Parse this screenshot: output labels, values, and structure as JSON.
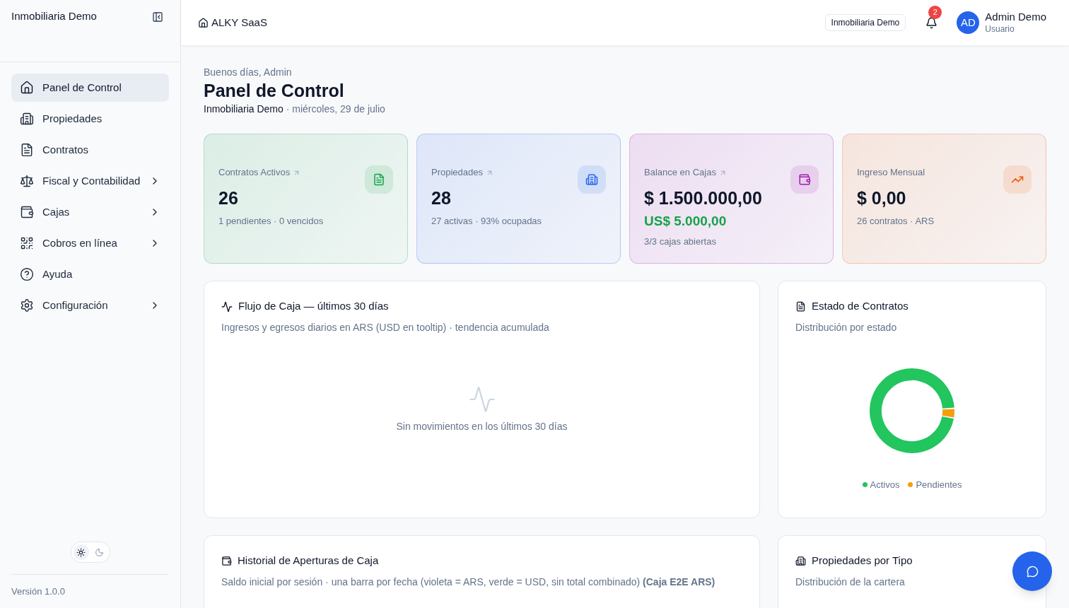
{
  "sidebar": {
    "org": "Inmobiliaria Demo",
    "items": [
      {
        "label": "Panel de Control",
        "selected": true,
        "expandable": false
      },
      {
        "label": "Propiedades",
        "selected": false,
        "expandable": false
      },
      {
        "label": "Contratos",
        "selected": false,
        "expandable": false
      },
      {
        "label": "Fiscal y Contabilidad",
        "selected": false,
        "expandable": true
      },
      {
        "label": "Cajas",
        "selected": false,
        "expandable": true
      },
      {
        "label": "Cobros en línea",
        "selected": false,
        "expandable": true
      },
      {
        "label": "Ayuda",
        "selected": false,
        "expandable": false
      },
      {
        "label": "Configuración",
        "selected": false,
        "expandable": true
      }
    ],
    "theme_options": [
      {
        "selected": true
      },
      {
        "selected": false
      }
    ],
    "version": "Versión 1.0.0"
  },
  "header": {
    "app": "ALKY SaaS",
    "org_badge": "Inmobiliaria Demo",
    "notifications": "2",
    "user": {
      "initials": "AD",
      "name": "Admin Demo",
      "role": "Usuario"
    }
  },
  "page": {
    "greeting": "Buenos días, Admin",
    "title": "Panel de Control",
    "org": "Inmobiliaria Demo",
    "date": "· miércoles, 29 de julio"
  },
  "stats": [
    {
      "label": "Contratos Activos",
      "linked": true,
      "value": "26",
      "detail": "1 pendientes · 0 vencidos",
      "color": "#16a34a"
    },
    {
      "label": "Propiedades",
      "linked": true,
      "value": "28",
      "detail": "27 activas · 93% ocupadas",
      "color": "#2563eb"
    },
    {
      "label": "Balance en Cajas",
      "linked": true,
      "value": "$ 1.500.000,00",
      "secondary": "US$ 5.000,00",
      "detail": "3/3 cajas abiertas",
      "color": "#a21caf"
    },
    {
      "label": "Ingreso Mensual",
      "linked": false,
      "value": "$ 0,00",
      "detail": "26 contratos · ARS",
      "color": "#ea580c"
    }
  ],
  "cash_flow": {
    "title": "Flujo de Caja — últimos 30 días",
    "subtitle": "Ingresos y egresos diarios en ARS (USD en tooltip) · tendencia acumulada",
    "empty": "Sin movimientos en los últimos 30 días"
  },
  "contracts_status": {
    "title": "Estado de Contratos",
    "subtitle": "Distribución por estado",
    "legend": [
      {
        "label": "Activos",
        "color": "#22c55e"
      },
      {
        "label": "Pendientes",
        "color": "#f59e0b"
      }
    ]
  },
  "cash_history": {
    "title": "Historial de Aperturas de Caja",
    "subtitle": "Saldo inicial por sesión · una barra por fecha (violeta = ARS, verde = USD, sin total combinado) **(Caja E2E ARS)**"
  },
  "property_types": {
    "title": "Propiedades por Tipo",
    "subtitle": "Distribución de la cartera"
  }
}
